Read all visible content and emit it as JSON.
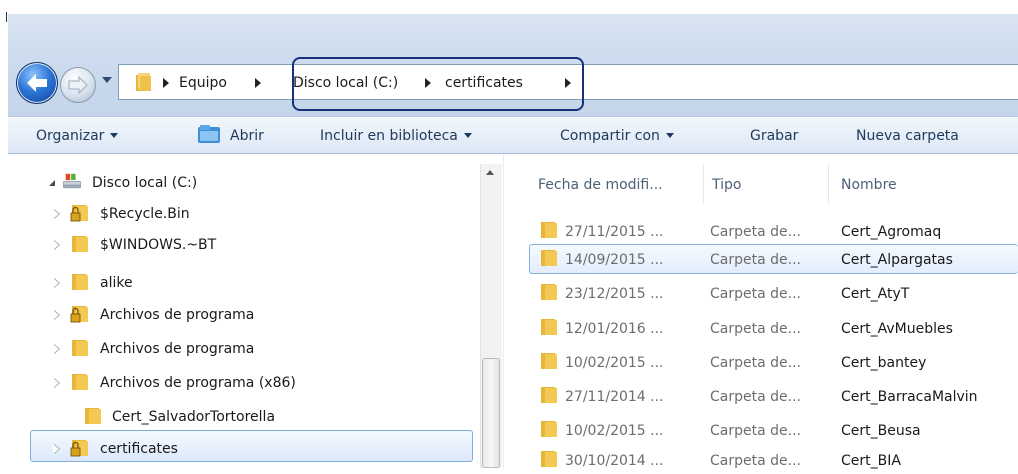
{
  "address_bar": {
    "crumbs": [
      "Equipo",
      "Disco local (C:)",
      "certificates"
    ]
  },
  "toolbar": {
    "organizar": "Organizar",
    "abrir": "Abrir",
    "incluir": "Incluir en biblioteca",
    "compartir": "Compartir con",
    "grabar": "Grabar",
    "nueva_carpeta": "Nueva carpeta"
  },
  "nav_tree": {
    "root": "Disco local (C:)",
    "items": [
      {
        "label": "$Recycle.Bin",
        "locked": true
      },
      {
        "label": "$WINDOWS.~BT",
        "locked": false
      },
      {
        "label": "alike",
        "locked": false
      },
      {
        "label": "Archivos de programa",
        "locked": true
      },
      {
        "label": "Archivos de programa",
        "locked": false
      },
      {
        "label": "Archivos de programa (x86)",
        "locked": false
      },
      {
        "label": "Cert_SalvadorTortorella",
        "locked": false
      },
      {
        "label": "certificates",
        "locked": true
      }
    ]
  },
  "file_list": {
    "columns": {
      "date": "Fecha de modifi...",
      "type": "Tipo",
      "name": "Nombre"
    },
    "rows": [
      {
        "date": "27/11/2015 ...",
        "type": "Carpeta de...",
        "name": "Cert_Agromaq"
      },
      {
        "date": "14/09/2015 ...",
        "type": "Carpeta de...",
        "name": "Cert_Alpargatas"
      },
      {
        "date": "23/12/2015 ...",
        "type": "Carpeta de...",
        "name": "Cert_AtyT"
      },
      {
        "date": "12/01/2016 ...",
        "type": "Carpeta de...",
        "name": "Cert_AvMuebles"
      },
      {
        "date": "10/02/2015 ...",
        "type": "Carpeta de...",
        "name": "Cert_bantey"
      },
      {
        "date": "27/11/2014 ...",
        "type": "Carpeta de...",
        "name": "Cert_BarracaMalvin"
      },
      {
        "date": "10/02/2015 ...",
        "type": "Carpeta de...",
        "name": "Cert_Beusa"
      },
      {
        "date": "30/10/2014 ...",
        "type": "Carpeta de...",
        "name": "Cert_BIA"
      }
    ]
  },
  "colors": {
    "highlight_box": "#17307a",
    "selection_border": "#84acdd",
    "toolbar_text": "#1e395b",
    "folder_yellow": "#e8b53a"
  },
  "icons": [
    "back-arrow-icon",
    "forward-arrow-icon",
    "folder-icon",
    "lock-icon",
    "drive-icon",
    "open-icon"
  ]
}
